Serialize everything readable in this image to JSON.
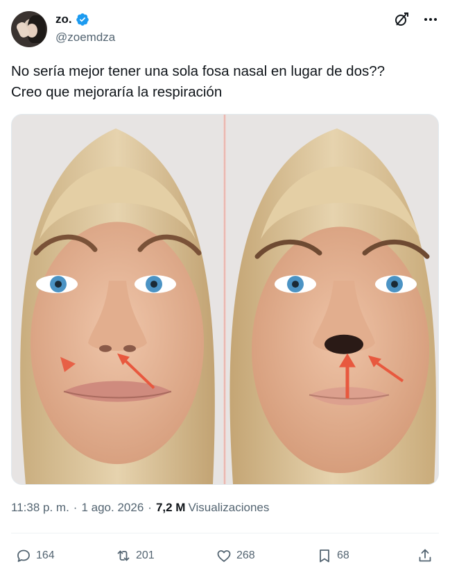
{
  "author": {
    "display_name": "zo.",
    "handle": "@zoemdza",
    "verified": true
  },
  "header_icons": [
    "grok-icon",
    "more-icon"
  ],
  "tweet": {
    "text": "No sería mejor tener una sola fosa nasal en lugar de dos??\nCreo que mejoraría la respiración"
  },
  "meta": {
    "time": "11:38 p. m.",
    "date": "1 ago. 2026",
    "views_count": "7,2 M",
    "views_label": "Visualizaciones"
  },
  "stats": {
    "replies": "164",
    "reposts": "201",
    "likes": "268",
    "bookmarks": "68"
  },
  "colors": {
    "text": "#0f1419",
    "secondary": "#536471",
    "verified": "#1d9bf0",
    "arrow": "#e8583e"
  }
}
